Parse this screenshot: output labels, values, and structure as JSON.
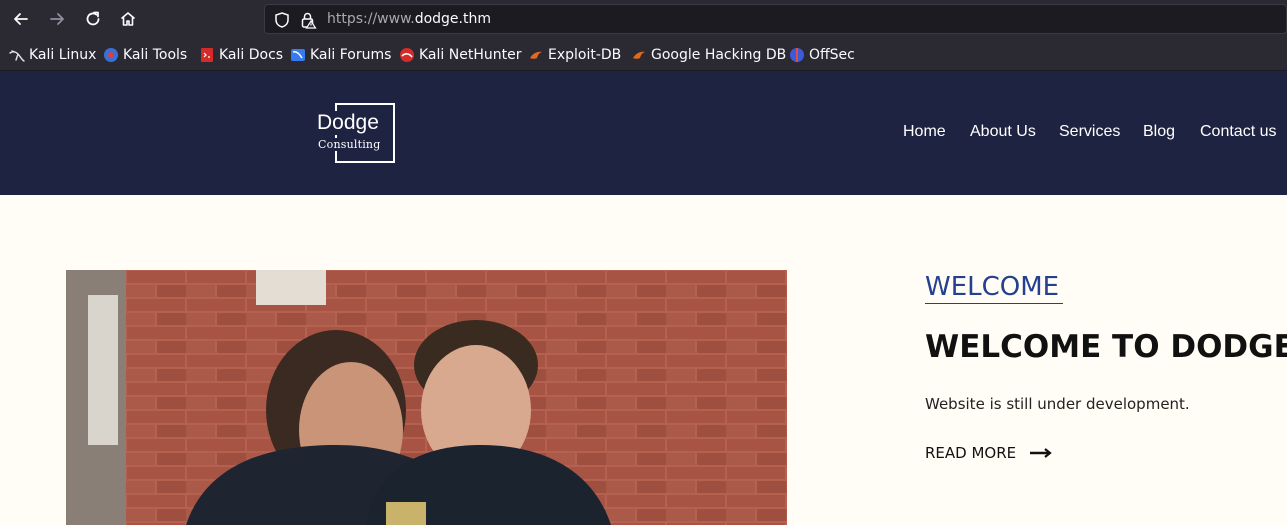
{
  "browser": {
    "url_prefix": "https://www.",
    "url_host": "dodge.thm",
    "nav_icons": [
      "back-icon",
      "forward-icon",
      "reload-icon",
      "home-icon"
    ],
    "bookmarks": [
      {
        "label": "Kali Linux",
        "icon": "kali-dragon-icon"
      },
      {
        "label": "Kali Tools",
        "icon": "kali-tools-icon"
      },
      {
        "label": "Kali Docs",
        "icon": "kali-docs-icon"
      },
      {
        "label": "Kali Forums",
        "icon": "kali-forums-icon"
      },
      {
        "label": "Kali NetHunter",
        "icon": "nethunter-icon"
      },
      {
        "label": "Exploit-DB",
        "icon": "exploit-db-icon"
      },
      {
        "label": "Google Hacking DB",
        "icon": "ghdb-icon"
      },
      {
        "label": "OffSec",
        "icon": "offsec-icon"
      }
    ]
  },
  "site": {
    "logo": {
      "title": "Dodge",
      "subtitle": "Consulting"
    },
    "nav": [
      "Home",
      "About Us",
      "Services",
      "Blog",
      "Contact us"
    ],
    "hero": {
      "kicker": "WELCOME",
      "heading": "WELCOME TO DODGE",
      "text": "Website is still under development.",
      "cta": "READ MORE"
    }
  },
  "colors": {
    "header_bg": "#1f2342",
    "page_bg": "#fffdf5",
    "accent_link": "#25408f",
    "chrome_bg": "#2b2a33"
  }
}
